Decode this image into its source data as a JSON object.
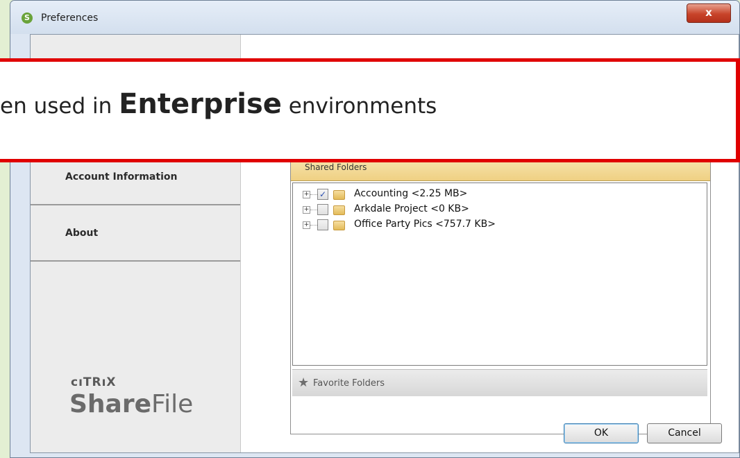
{
  "window": {
    "title": "Preferences",
    "app_icon_glyph": "S",
    "close_glyph": "x"
  },
  "sidebar": {
    "items": [
      {
        "label": "Account Information"
      },
      {
        "label": "About"
      }
    ],
    "brand": {
      "company": "cıTRıX",
      "product_bold": "Share",
      "product_light": "File"
    }
  },
  "banner": {
    "prefix": "en used in ",
    "emphasis": "Enterprise",
    "suffix": " environments"
  },
  "panel": {
    "header_label": "Shared Folders",
    "folders": [
      {
        "name": "Accounting <2.25 MB>",
        "checked": true
      },
      {
        "name": "Arkdale Project <0 KB>",
        "checked": false
      },
      {
        "name": "Office Party Pics <757.7 KB>",
        "checked": false
      }
    ],
    "favorites_label": "Favorite Folders"
  },
  "buttons": {
    "ok": "OK",
    "cancel": "Cancel"
  }
}
